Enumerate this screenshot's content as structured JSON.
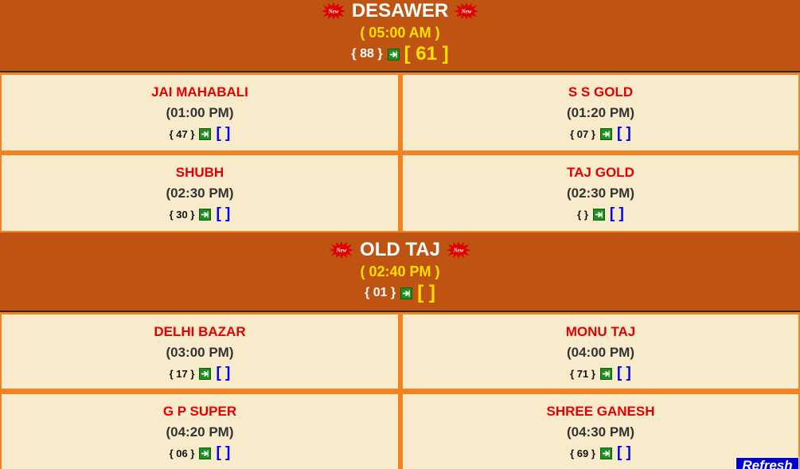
{
  "colors": {
    "page_bg": "#f58220",
    "banner_bg": "#bf5312",
    "cell_bg": "#f7ebcc",
    "name_red": "#e30000",
    "result_blue": "#0000ee",
    "time_yellow": "#ffe100"
  },
  "featured": [
    {
      "title": "DESAWER",
      "time": "( 05:00 AM )",
      "left": "{ 88 }",
      "result": "[ 61 ]",
      "badge": "New"
    },
    {
      "title": "OLD TAJ",
      "time": "( 02:40 PM )",
      "left": "{ 01 }",
      "result": "[ ]",
      "badge": "New"
    }
  ],
  "grid1": [
    {
      "name": "JAI MAHABALI",
      "time": "(01:00 PM)",
      "left": "{ 47 }",
      "result": "[ ]"
    },
    {
      "name": "S S GOLD",
      "time": "(01:20 PM)",
      "left": "{ 07 }",
      "result": "[ ]"
    },
    {
      "name": "SHUBH",
      "time": "(02:30 PM)",
      "left": "{ 30 }",
      "result": "[ ]"
    },
    {
      "name": "TAJ GOLD",
      "time": "(02:30 PM)",
      "left": "{ }",
      "result": "[ ]"
    }
  ],
  "grid2": [
    {
      "name": "DELHI BAZAR",
      "time": "(03:00 PM)",
      "left": "{ 17 }",
      "result": "[ ]"
    },
    {
      "name": "MONU TAJ",
      "time": "(04:00 PM)",
      "left": "{ 71 }",
      "result": "[ ]"
    },
    {
      "name": "G P SUPER",
      "time": "(04:20 PM)",
      "left": "{ 06 }",
      "result": "[ ]"
    },
    {
      "name": "SHREE GANESH",
      "time": "(04:30 PM)",
      "left": "{ 69 }",
      "result": "[ ]"
    }
  ],
  "refresh": {
    "label": "Refresh"
  }
}
